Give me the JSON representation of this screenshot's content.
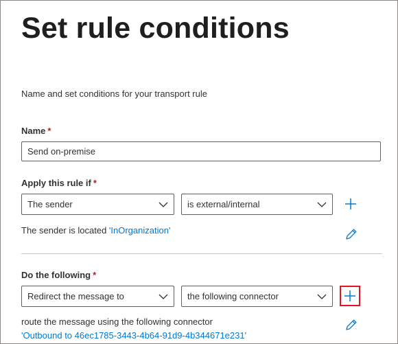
{
  "page": {
    "title": "Set rule conditions",
    "subtitle": "Name and set conditions for your transport rule"
  },
  "name_section": {
    "label": "Name",
    "required_mark": "*",
    "value": "Send on-premise"
  },
  "apply_section": {
    "label": "Apply this rule if",
    "required_mark": "*",
    "condition_dropdown": "The sender",
    "operator_dropdown": "is external/internal",
    "summary_prefix": "The sender is located",
    "summary_value": "'InOrganization'"
  },
  "action_section": {
    "label": "Do the following",
    "required_mark": "*",
    "action_dropdown": "Redirect the message to",
    "target_dropdown": "the following connector",
    "summary_text": "route the message using the following connector",
    "summary_value": "'Outbound to 46ec1785-3443-4b64-91d9-4b344671e231'"
  },
  "icons": {
    "add": "plus-icon",
    "edit": "pencil-icon",
    "dropdown": "chevron-down-icon"
  },
  "colors": {
    "accent": "#0078d4",
    "required": "#a4262c",
    "highlight": "#e81123"
  }
}
